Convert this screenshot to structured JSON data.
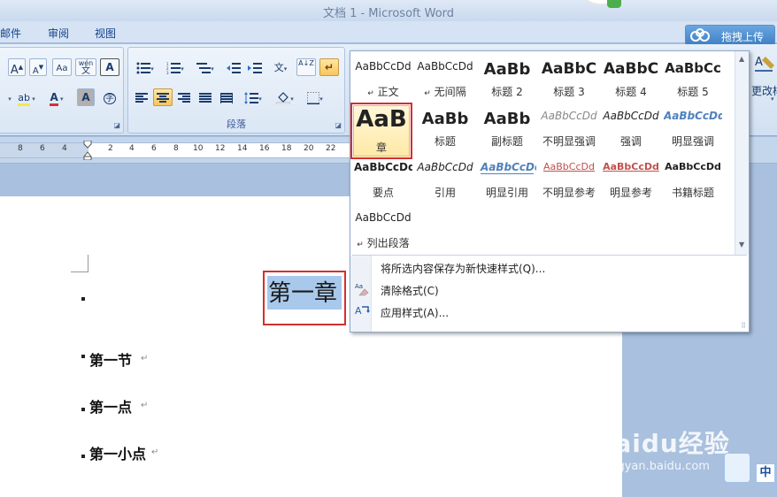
{
  "window": {
    "title": "文档 1 - Microsoft Word"
  },
  "tabs": [
    "邮件",
    "审阅",
    "视图"
  ],
  "upload_button": {
    "label": "拖拽上传",
    "icon": "cloud-icon"
  },
  "ribbon": {
    "font_group": {
      "grow_font": "A",
      "shrink_font": "A",
      "change_case": "Aa",
      "phonetic": "wén",
      "phonetic_sub": "文",
      "char_border": "A",
      "highlight": "ab",
      "font_color": "A",
      "char_shading": "A",
      "enclose": "字"
    },
    "paragraph_group": {
      "label": "段落",
      "bullets_icon": "bullets-icon",
      "numbering_icon": "numbering-icon",
      "multilevel_icon": "multilevel-list-icon",
      "decrease_indent_icon": "decrease-indent-icon",
      "increase_indent_icon": "increase-indent-icon",
      "chinese_layout": "文",
      "sort": "A↓Z",
      "show_marks": "↵",
      "align_left_icon": "align-left-icon",
      "center_icon": "align-center-icon",
      "align_right_icon": "align-right-icon",
      "justify_icon": "justify-icon",
      "distribute_icon": "distribute-icon",
      "line_spacing_icon": "line-spacing-icon",
      "shading_icon": "shading-icon",
      "borders_icon": "borders-icon"
    },
    "change_styles_label": "更改样"
  },
  "ruler": {
    "left_numbers": [
      "8",
      "6",
      "4",
      "2"
    ],
    "right_numbers": [
      "2",
      "4",
      "6",
      "8",
      "10",
      "12",
      "14",
      "16",
      "18",
      "20",
      "22"
    ]
  },
  "document": {
    "selected_heading": "第一章",
    "lines": [
      "第一节",
      "第一点",
      "第一小点"
    ],
    "para_mark": "↵"
  },
  "styles_gallery": {
    "rows": [
      [
        {
          "sample": "AaBbCcDd",
          "name": "正文",
          "mark": "↵"
        },
        {
          "sample": "AaBbCcDd",
          "name": "无间隔",
          "mark": "↵"
        },
        {
          "sample": "AaBb",
          "name": "标题 2"
        },
        {
          "sample": "AaBbC",
          "name": "标题 3"
        },
        {
          "sample": "AaBbC",
          "name": "标题 4"
        },
        {
          "sample": "AaBbCc",
          "name": "标题 5"
        }
      ],
      [
        {
          "sample": "AaB",
          "name": "章",
          "selected": true
        },
        {
          "sample": "AaBb",
          "name": "标题"
        },
        {
          "sample": "AaBb",
          "name": "副标题"
        },
        {
          "sample": "AaBbCcDd",
          "name": "不明显强调"
        },
        {
          "sample": "AaBbCcDd",
          "name": "强调"
        },
        {
          "sample": "AaBbCcDd",
          "name": "明显强调"
        }
      ],
      [
        {
          "sample": "AaBbCcDd",
          "name": "要点"
        },
        {
          "sample": "AaBbCcDd",
          "name": "引用"
        },
        {
          "sample": "AaBbCcDd",
          "name": "明显引用"
        },
        {
          "sample": "AaBbCcDd",
          "name": "不明显参考"
        },
        {
          "sample": "AaBbCcDd",
          "name": "明显参考"
        },
        {
          "sample": "AaBbCcDd",
          "name": "书籍标题"
        }
      ],
      [
        {
          "sample": "AaBbCcDd",
          "name": "列出段落",
          "mark": "↵"
        }
      ]
    ],
    "menu": [
      {
        "label": "将所选内容保存为新快速样式(Q)...",
        "icon": "save-style-icon"
      },
      {
        "label": "清除格式(C)",
        "icon": "clear-format-icon"
      },
      {
        "label": "应用样式(A)...",
        "icon": "apply-styles-icon"
      }
    ]
  },
  "watermark": {
    "brand": "Baidu经验",
    "url": "jingyan.baidu.com"
  },
  "ime": {
    "mode": "中"
  },
  "colors": {
    "ribbon_bg": "#dbe7f5",
    "highlight_box": "#d32f2f",
    "selection": "#a8c8ec",
    "accent_selected": "#f8c55c"
  }
}
